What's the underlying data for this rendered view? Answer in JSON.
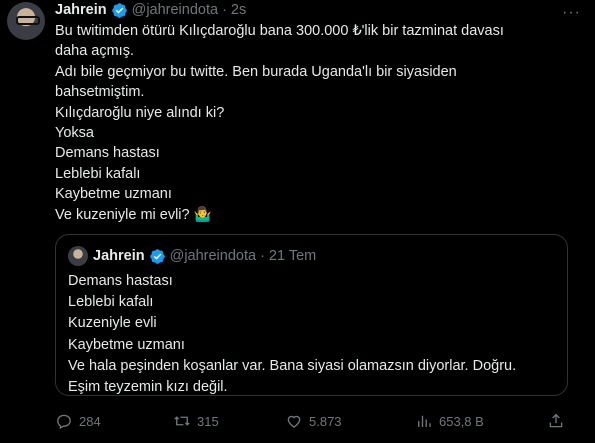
{
  "tweet": {
    "author": {
      "name": "Jahrein",
      "handle": "@jahreindota",
      "time": "2s"
    },
    "lines": [
      "Bu twitimden ötürü Kılıçdaroğlu bana 300.000 ₺'lik bir tazminat davası",
      "daha açmış.",
      "Adı bile geçmiyor bu twitte. Ben burada Uganda'lı bir siyasiden",
      "bahsetmiştim.",
      "Kılıçdaroğlu niye alındı ki?",
      "Yoksa",
      "Demans hastası",
      "Leblebi kafalı",
      "Kaybetme uzmanı",
      "Ve kuzeniyle mi evli? 🤷‍♂️"
    ],
    "quoted": {
      "name": "Jahrein",
      "handle": "@jahreindota",
      "time": "21 Tem",
      "lines": [
        "Demans hastası",
        "Leblebi kafalı",
        "Kuzeniyle evli",
        "Kaybetme uzmanı",
        "Ve hala peşinden koşanlar var. Bana siyasi olamazsın diyorlar. Doğru.",
        "Eşim teyzemin kızı değil."
      ]
    },
    "actions": {
      "replies": "284",
      "retweets": "315",
      "likes": "5.873",
      "views": "653,8 B"
    }
  },
  "icons": {
    "more": "more-icon",
    "verified": "verified-badge-icon",
    "reply": "reply-icon",
    "retweet": "retweet-icon",
    "like": "heart-icon",
    "views": "views-icon",
    "share": "share-icon"
  },
  "colors": {
    "background": "#000000",
    "text": "#e7e9ea",
    "muted": "#71767b",
    "verified": "#1d9bf0",
    "border": "#2f3336"
  }
}
